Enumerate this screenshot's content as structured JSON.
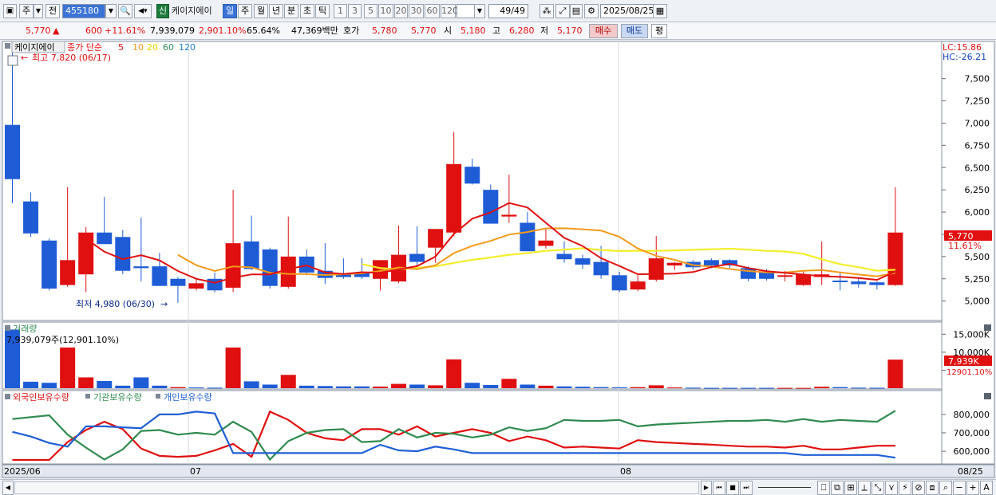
{
  "toolbar": {
    "market": "주",
    "prev": "전",
    "code": "455180",
    "badge": "신",
    "name": "케이지에이",
    "periods": [
      "일",
      "주",
      "월",
      "년",
      "분",
      "초",
      "틱"
    ],
    "active_period": "일",
    "intervals": [
      "1",
      "3",
      "5",
      "10",
      "20",
      "30",
      "60",
      "120"
    ],
    "count": "49/49",
    "date": "2025/08/25"
  },
  "quote": {
    "price": "5,770",
    "arrow": "▲",
    "change": "600",
    "change_pct": "+11.61%",
    "volume": "7,939,079",
    "volume_ratio": "2,901.10%",
    "turnover": "65.64%",
    "amount": "47,369백만",
    "bid_label": "호가",
    "ask": "5,780",
    "bid": "5,770",
    "open_label": "시",
    "open": "5,180",
    "high_label": "고",
    "high": "6,280",
    "low_label": "저",
    "low": "5,170",
    "buy_label": "매수",
    "sell_label": "매도",
    "eval_label": "평"
  },
  "colors": {
    "up": "#e01010",
    "down": "#1e5cd6",
    "ma5": "#e01010",
    "ma10": "#f39a1b",
    "ma20": "#f4ee2a",
    "ma60": "#2e8b57",
    "ma120": "#1f7fd6"
  },
  "price_panel": {
    "name_tag": "케이지에이",
    "legend": [
      "종가 단순",
      "5",
      "10",
      "20",
      "60",
      "120"
    ],
    "lc": "LC:15.86",
    "hc": "HC:-26.21",
    "high_note": "최고 7,820 (06/17)",
    "low_note": "최저 4,980 (06/30)",
    "last_price_tag": "5,770",
    "last_pct_tag": "11.61%"
  },
  "volume_panel": {
    "title": "거래량",
    "value": "7,939,079주(12,901.10%)",
    "last_tag": "7,939K",
    "last_pct": "12901.10%"
  },
  "holding_panel": {
    "legend": [
      "외국인보유수량",
      "기관보유수량",
      "개인보유수량"
    ]
  },
  "x_labels": {
    "start": "2025/06",
    "m2": "07",
    "m3": "08",
    "end": "08/25"
  },
  "chart_data": [
    {
      "type": "candlestick",
      "ylim": [
        4800,
        7900
      ],
      "yticks": [
        5000,
        5250,
        5500,
        5750,
        6000,
        6250,
        6500,
        6750,
        7000,
        7250,
        7500
      ],
      "ytick_labels": [
        "5,000",
        "5,250",
        "5,500",
        "5,750",
        "6,000",
        "6,250",
        "6,500",
        "6,750",
        "7,000",
        "7,250",
        "7,500"
      ],
      "candles": [
        [
          6980,
          7820,
          6100,
          6370
        ],
        [
          6120,
          6220,
          5720,
          5760
        ],
        [
          5680,
          5700,
          5120,
          5140
        ],
        [
          5180,
          6280,
          5160,
          5460
        ],
        [
          5300,
          5830,
          5100,
          5770
        ],
        [
          5770,
          6170,
          5640,
          5640
        ],
        [
          5720,
          5800,
          5300,
          5340
        ],
        [
          5390,
          5940,
          5220,
          5370
        ],
        [
          5390,
          5540,
          5170,
          5170
        ],
        [
          5250,
          5270,
          4980,
          5170
        ],
        [
          5140,
          5260,
          5120,
          5200
        ],
        [
          5250,
          5320,
          5100,
          5120
        ],
        [
          5150,
          6250,
          5100,
          5650
        ],
        [
          5670,
          5960,
          5350,
          5360
        ],
        [
          5580,
          5600,
          5140,
          5170
        ],
        [
          5160,
          5950,
          5140,
          5500
        ],
        [
          5500,
          5580,
          5290,
          5320
        ],
        [
          5340,
          5650,
          5190,
          5260
        ],
        [
          5300,
          5480,
          5250,
          5270
        ],
        [
          5320,
          5480,
          5250,
          5270
        ],
        [
          5250,
          5340,
          5120,
          5460
        ],
        [
          5220,
          5850,
          5200,
          5520
        ],
        [
          5530,
          5840,
          5400,
          5440
        ],
        [
          5600,
          5730,
          5430,
          5810
        ],
        [
          5770,
          6900,
          5730,
          6540
        ],
        [
          6510,
          6600,
          6310,
          6320
        ],
        [
          6250,
          6310,
          5870,
          5870
        ],
        [
          5950,
          6420,
          5880,
          5970
        ],
        [
          5880,
          6000,
          5560,
          5560
        ],
        [
          5620,
          5810,
          5590,
          5680
        ],
        [
          5530,
          5670,
          5430,
          5470
        ],
        [
          5480,
          5520,
          5360,
          5410
        ],
        [
          5440,
          5620,
          5250,
          5290
        ],
        [
          5290,
          5330,
          5100,
          5120
        ],
        [
          5130,
          5290,
          5110,
          5220
        ],
        [
          5240,
          5730,
          5220,
          5480
        ],
        [
          5400,
          5440,
          5350,
          5430
        ],
        [
          5440,
          5460,
          5350,
          5380
        ],
        [
          5460,
          5480,
          5370,
          5400
        ],
        [
          5460,
          5470,
          5370,
          5400
        ],
        [
          5370,
          5390,
          5220,
          5250
        ],
        [
          5320,
          5360,
          5230,
          5250
        ],
        [
          5290,
          5340,
          5220,
          5290
        ],
        [
          5180,
          5340,
          5170,
          5300
        ],
        [
          5270,
          5670,
          5180,
          5300
        ],
        [
          5230,
          5330,
          5120,
          5220
        ],
        [
          5220,
          5270,
          5150,
          5190
        ],
        [
          5210,
          5220,
          5130,
          5180
        ],
        [
          5180,
          6280,
          5170,
          5770
        ]
      ]
    },
    {
      "type": "bar",
      "ylim": [
        0,
        17500
      ],
      "yticks": [
        5000,
        10000,
        15000
      ],
      "ytick_labels": [
        "",
        "10,000K",
        "15,000K"
      ],
      "values": [
        16300,
        1800,
        1500,
        11300,
        3000,
        2000,
        700,
        3000,
        700,
        300,
        200,
        150,
        11300,
        1900,
        1000,
        3700,
        700,
        600,
        500,
        500,
        450,
        1200,
        1000,
        800,
        8000,
        1500,
        900,
        2600,
        1000,
        700,
        500,
        400,
        300,
        250,
        300,
        800,
        200,
        150,
        100,
        100,
        100,
        100,
        100,
        80,
        400,
        300,
        150,
        120,
        7939
      ],
      "directions": [
        "down",
        "down",
        "down",
        "up",
        "up",
        "down",
        "down",
        "down",
        "down",
        "up",
        "down",
        "down",
        "up",
        "down",
        "down",
        "up",
        "down",
        "down",
        "down",
        "down",
        "up",
        "up",
        "down",
        "up",
        "up",
        "down",
        "down",
        "up",
        "down",
        "up",
        "down",
        "down",
        "down",
        "down",
        "up",
        "up",
        "up",
        "down",
        "down",
        "down",
        "down",
        "down",
        "up",
        "up",
        "up",
        "down",
        "down",
        "down",
        "up"
      ]
    },
    {
      "type": "line",
      "ylim": [
        540000,
        860000
      ],
      "yticks": [
        600000,
        700000,
        800000
      ],
      "ytick_labels": [
        "600,000",
        "700,000",
        "800,000"
      ],
      "series": [
        {
          "name": "외국인보유수량",
          "color": "#e01010",
          "values": [
            553000,
            553000,
            553000,
            650000,
            715000,
            760000,
            720000,
            615000,
            575000,
            570000,
            575000,
            605000,
            640000,
            570000,
            815000,
            770000,
            700000,
            670000,
            660000,
            720000,
            720000,
            690000,
            735000,
            680000,
            700000,
            720000,
            700000,
            655000,
            680000,
            660000,
            620000,
            625000,
            620000,
            615000,
            660000,
            650000,
            645000,
            640000,
            636000,
            630000,
            625000,
            625000,
            620000,
            630000,
            610000,
            610000,
            620000,
            630000,
            630000
          ]
        },
        {
          "name": "기관보유수량",
          "color": "#2f8a4f",
          "values": [
            775000,
            785000,
            795000,
            690000,
            620000,
            555000,
            610000,
            710000,
            715000,
            690000,
            700000,
            690000,
            760000,
            705000,
            555000,
            655000,
            700000,
            715000,
            720000,
            650000,
            655000,
            720000,
            675000,
            700000,
            695000,
            675000,
            690000,
            730000,
            710000,
            725000,
            770000,
            765000,
            765000,
            770000,
            735000,
            745000,
            750000,
            755000,
            760000,
            765000,
            765000,
            770000,
            760000,
            775000,
            760000,
            770000,
            765000,
            760000,
            820000
          ]
        },
        {
          "name": "개인보유수량",
          "color": "#1f5fd6",
          "values": [
            705000,
            680000,
            645000,
            625000,
            735000,
            735000,
            730000,
            725000,
            800000,
            800000,
            815000,
            805000,
            590000,
            590000,
            590000,
            590000,
            590000,
            590000,
            590000,
            590000,
            635000,
            605000,
            600000,
            625000,
            610000,
            590000,
            590000,
            590000,
            590000,
            590000,
            590000,
            590000,
            590000,
            590000,
            590000,
            590000,
            590000,
            590000,
            590000,
            590000,
            590000,
            590000,
            590000,
            580000,
            580000,
            580000,
            580000,
            580000,
            565000
          ]
        }
      ]
    }
  ]
}
